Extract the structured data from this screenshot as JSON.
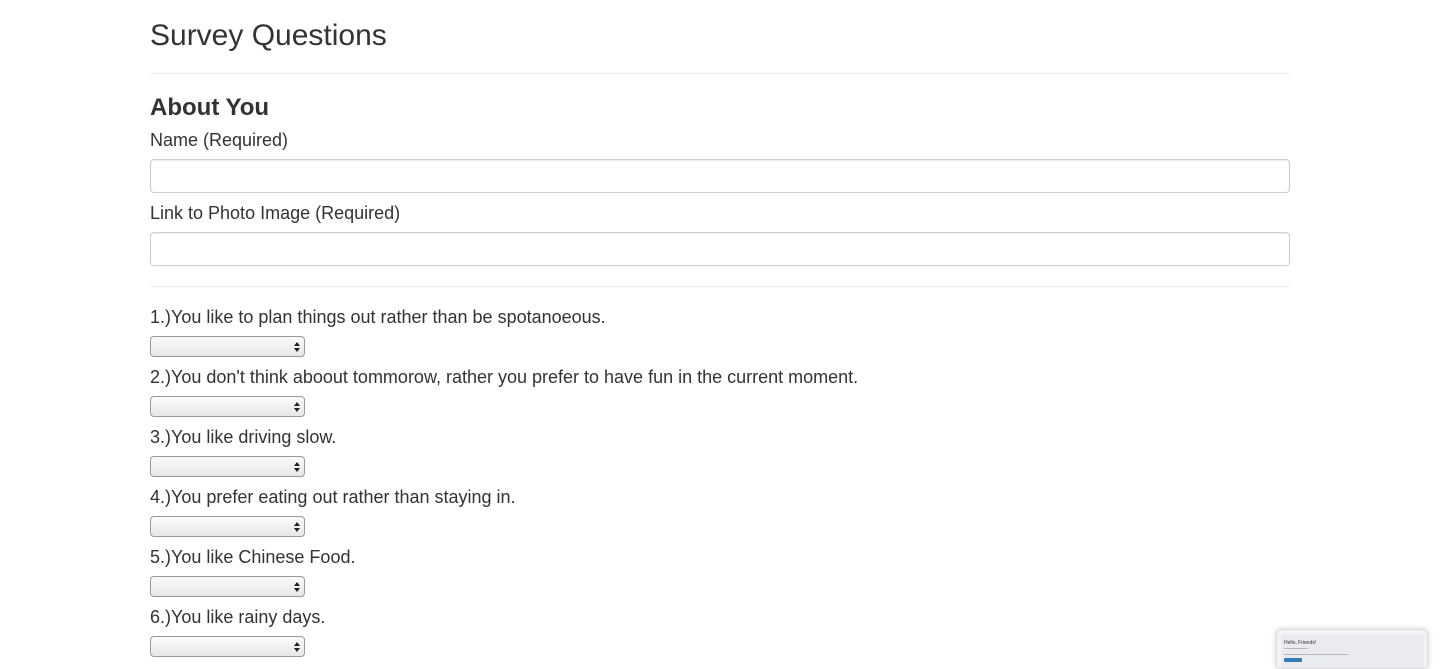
{
  "page": {
    "title": "Survey Questions"
  },
  "about": {
    "heading": "About You",
    "name_label": "Name (Required)",
    "name_value": "",
    "photo_label": "Link to Photo Image (Required)",
    "photo_value": ""
  },
  "questions": [
    {
      "label": "1.)You like to plan things out rather than be spotanoeous.",
      "selected": ""
    },
    {
      "label": "2.)You don't think aboout tommorow, rather you prefer to have fun in the current moment.",
      "selected": ""
    },
    {
      "label": "3.)You like driving slow.",
      "selected": ""
    },
    {
      "label": "4.)You prefer eating out rather than staying in.",
      "selected": ""
    },
    {
      "label": "5.)You like Chinese Food.",
      "selected": ""
    },
    {
      "label": "6.)You like rainy days.",
      "selected": ""
    }
  ],
  "thumbnail": {
    "title": "Hello, Friends!"
  },
  "colors": {
    "text": "#333333",
    "divider": "#eeeeee",
    "input_border": "#cccccc",
    "thumbnail_button": "#337ab7"
  }
}
